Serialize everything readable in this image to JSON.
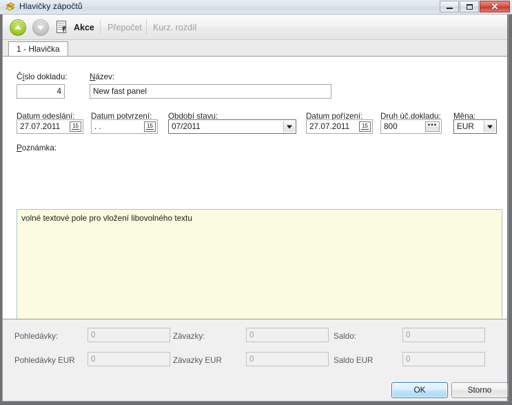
{
  "window": {
    "title": "Hlavičky zápočtů",
    "app_icon": "app-icon",
    "buttons": {
      "minimize": "minimize-icon",
      "maximize": "maximize-icon",
      "close": "✕"
    }
  },
  "toolbar": {
    "nav_up": "up-arrow-icon",
    "nav_down": "down-arrow-icon",
    "action_icon": "document-cursor-icon",
    "action_label": "Akce",
    "recalc_label": "Přepočet",
    "rate_diff_label": "Kurz. rozdíl"
  },
  "tabs": [
    {
      "label": "1 - Hlavička",
      "active": true
    }
  ],
  "form": {
    "doc_number": {
      "label": "Číslo dokladu:",
      "accel": "s",
      "value": "4"
    },
    "name": {
      "label": "Název:",
      "accel": "N",
      "value": "New fast panel"
    },
    "sent_date": {
      "label": "Datum odeslání:",
      "accel": "D",
      "value": "27.07.2011",
      "calendar_icon": "15"
    },
    "confirm_date": {
      "label": "Datum potvrzení:",
      "accel": "a",
      "value": ".  .",
      "calendar_icon": "15"
    },
    "period": {
      "label": "Období stavu:",
      "accel": "O",
      "value": "07/2011"
    },
    "created_date": {
      "label": "Datum pořízení:",
      "accel": "t",
      "value": "27.07.2011",
      "calendar_icon": "15"
    },
    "doc_type": {
      "label": "Druh úč.dokladu:",
      "accel": "r",
      "value": "800",
      "lookup_label": "•••"
    },
    "currency": {
      "label": "Měna:",
      "accel": "ě",
      "value": "EUR"
    },
    "note": {
      "label": "Poznámka:",
      "accel": "P",
      "value": "volné textové pole pro vložení libovolného textu"
    }
  },
  "totals": {
    "rows": [
      [
        {
          "label": "Pohledávky:",
          "value": "0"
        },
        {
          "label": "Závazky:",
          "value": "0"
        },
        {
          "label": "Saldo:",
          "value": "0"
        }
      ],
      [
        {
          "label": "Pohledávky EUR",
          "value": "0"
        },
        {
          "label": "Závazky EUR",
          "value": "0"
        },
        {
          "label": "Saldo EUR",
          "value": "0"
        }
      ]
    ]
  },
  "dialog_buttons": {
    "ok": "OK",
    "cancel": "Storno"
  },
  "colors": {
    "accent_green": "#a8cf34",
    "memo_bg": "#fbfbdf",
    "default_button_border": "#3c7fb1",
    "close_button": "#c13a2d"
  }
}
